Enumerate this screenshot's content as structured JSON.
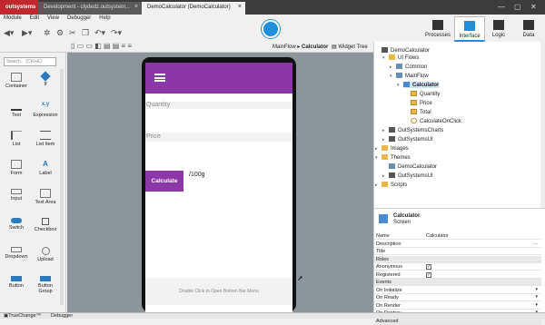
{
  "tabs": [
    {
      "label": "outsystems"
    },
    {
      "label": "Development - clydedz.outsystem..."
    },
    {
      "label": "DemoCalculator (DemoCalculator)"
    }
  ],
  "window_controls": {
    "minimize": "—",
    "maximize": "▢",
    "close": "✕"
  },
  "menu": [
    "Module",
    "Edit",
    "View",
    "Debugger",
    "Help"
  ],
  "topnav": [
    {
      "label": "Processes"
    },
    {
      "label": "Interface"
    },
    {
      "label": "Logic"
    },
    {
      "label": "Data"
    }
  ],
  "breadcrumb": {
    "flow": "MainFlow",
    "sep": "▸",
    "screen": "Calculator"
  },
  "widget_tree_label": "Widget Tree",
  "toolbox": {
    "search_placeholder": "Search... (Ctrl+E)",
    "widgets": [
      {
        "label": "Container"
      },
      {
        "label": "If"
      },
      {
        "label": "Text"
      },
      {
        "label": "Expression"
      },
      {
        "label": "List"
      },
      {
        "label": "List Item"
      },
      {
        "label": "Form"
      },
      {
        "label": "Label"
      },
      {
        "label": "Input"
      },
      {
        "label": "Text Area"
      },
      {
        "label": "Switch"
      },
      {
        "label": "Checkbox"
      },
      {
        "label": "Dropdown"
      },
      {
        "label": "Upload"
      },
      {
        "label": "Button"
      },
      {
        "label": "Button Group"
      }
    ],
    "expression_icon": "x.y"
  },
  "canvas": {
    "quantity_label": "Quantity",
    "price_label": "Price",
    "calculate_button": "Calculate",
    "result_text": "/100g",
    "bottom_bar_hint": "Double Click to Open Bottom Bar Menu"
  },
  "tree": {
    "module": "DemoCalculator",
    "ui_flows": "UI Flows",
    "common": "Common",
    "mainflow": "MainFlow",
    "calculator": "Calculator",
    "quantity": "Quantity",
    "price": "Price",
    "total": "Total",
    "action": "CalculateOnClick",
    "charts": "OutSystemsCharts",
    "ui": "OutSystemsUI",
    "images": "Images",
    "themes": "Themes",
    "theme_demo": "DemoCalculator",
    "theme_ui": "OutSystemsUI",
    "scripts": "Scripts"
  },
  "properties": {
    "name": "Calculator",
    "type": "Screen",
    "rows": [
      {
        "key": "Name",
        "value": "Calculator"
      },
      {
        "key": "Description",
        "value": ""
      },
      {
        "key": "Title",
        "value": ""
      }
    ],
    "roles_header": "Roles",
    "anonymous": "Anonymous",
    "registered": "Registered",
    "check": "✓",
    "events_header": "Events",
    "events": [
      "On Initialize",
      "On Ready",
      "On Render",
      "On Destroy"
    ],
    "advanced_header": "Advanced"
  },
  "statusbar": {
    "truechange": "TrueChange™",
    "debugger": "Debugger"
  },
  "colors": {
    "accent": "#8b37a8",
    "brand": "#c1272d",
    "nav_blue": "#1e8fd8"
  }
}
